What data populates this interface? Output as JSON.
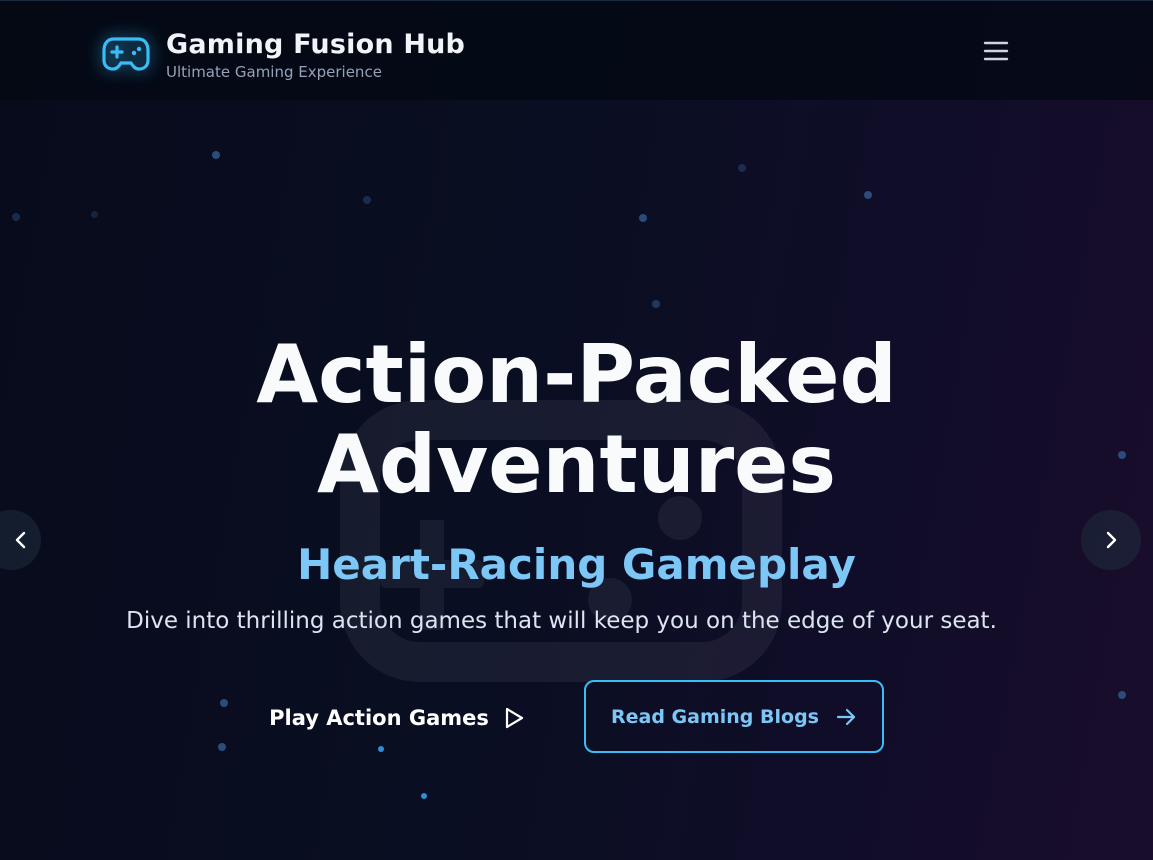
{
  "header": {
    "brand_title": "Gaming Fusion Hub",
    "brand_subtitle": "Ultimate Gaming Experience",
    "logo_icon": "gamepad-icon",
    "menu_icon": "hamburger-menu-icon"
  },
  "hero": {
    "title_line1": "Action-Packed",
    "title_line2": "Adventures",
    "subtitle": "Heart-Racing Gameplay",
    "description": "Dive into thrilling action games that will keep you on the edge of your seat.",
    "primary_button": {
      "label": "Play Action Games",
      "icon": "play-icon"
    },
    "secondary_button": {
      "label": "Read Gaming Blogs",
      "icon": "arrow-right-icon"
    }
  },
  "carousel": {
    "prev_icon": "chevron-left-icon",
    "next_icon": "chevron-right-icon"
  },
  "colors": {
    "accent": "#38bdf8",
    "subtitle": "#7cc7f5",
    "background": "#0a0f20",
    "text": "#f8fafc"
  }
}
